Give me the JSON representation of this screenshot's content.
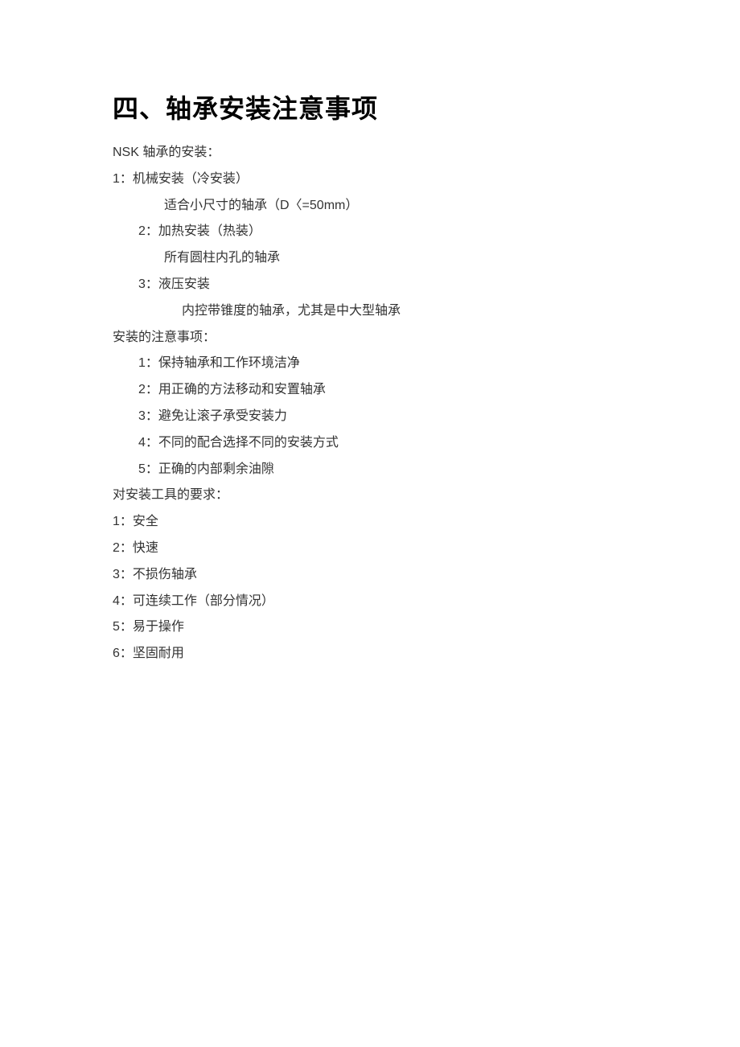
{
  "title": "四、轴承安装注意事项",
  "section1_heading": "NSK 轴承的安装：",
  "install_methods": {
    "m1_label": "1：机械安装（冷安装）",
    "m1_desc": "适合小尺寸的轴承（D〈=50mm）",
    "m2_label": "2：加热安装（热装）",
    "m2_desc": "所有圆柱内孔的轴承",
    "m3_label": "3：液压安装",
    "m3_desc": "内控带锥度的轴承，尤其是中大型轴承"
  },
  "section2_heading": "安装的注意事项：",
  "precautions": {
    "p1": "1：保持轴承和工作环境洁净",
    "p2": "2：用正确的方法移动和安置轴承",
    "p3": "3：避免让滚子承受安装力",
    "p4": "4：不同的配合选择不同的安装方式",
    "p5": "5：正确的内部剩余油隙"
  },
  "section3_heading": "对安装工具的要求：",
  "tool_reqs": {
    "t1": "1：安全",
    "t2": "2：快速",
    "t3": "3：不损伤轴承",
    "t4": "4：可连续工作（部分情况）",
    "t5": "5：易于操作",
    "t6": "6：坚固耐用"
  }
}
